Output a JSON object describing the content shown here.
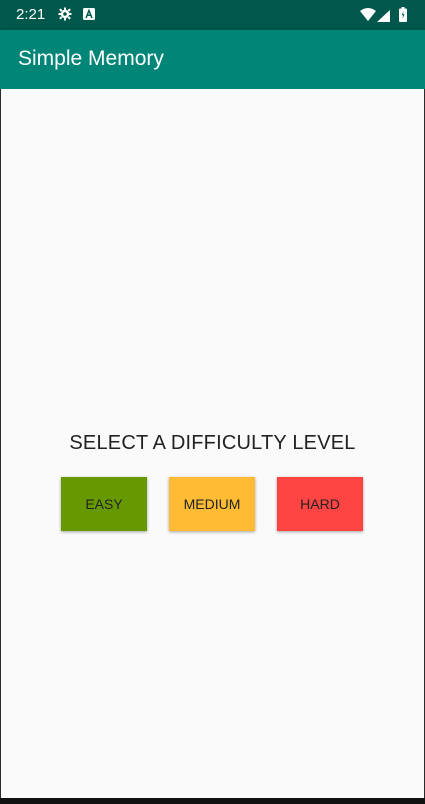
{
  "status_bar": {
    "time": "2:21",
    "icons": [
      "settings-icon",
      "a-notification-icon",
      "wifi-icon",
      "signal-icon",
      "battery-icon"
    ]
  },
  "app_bar": {
    "title": "Simple Memory",
    "color": "#008577",
    "status_color": "#00574b"
  },
  "main": {
    "prompt": "SELECT A DIFFICULTY LEVEL",
    "buttons": [
      {
        "label": "EASY",
        "color": "#669900"
      },
      {
        "label": "MEDIUM",
        "color": "#ffbb33"
      },
      {
        "label": "HARD",
        "color": "#ff4444"
      }
    ]
  }
}
